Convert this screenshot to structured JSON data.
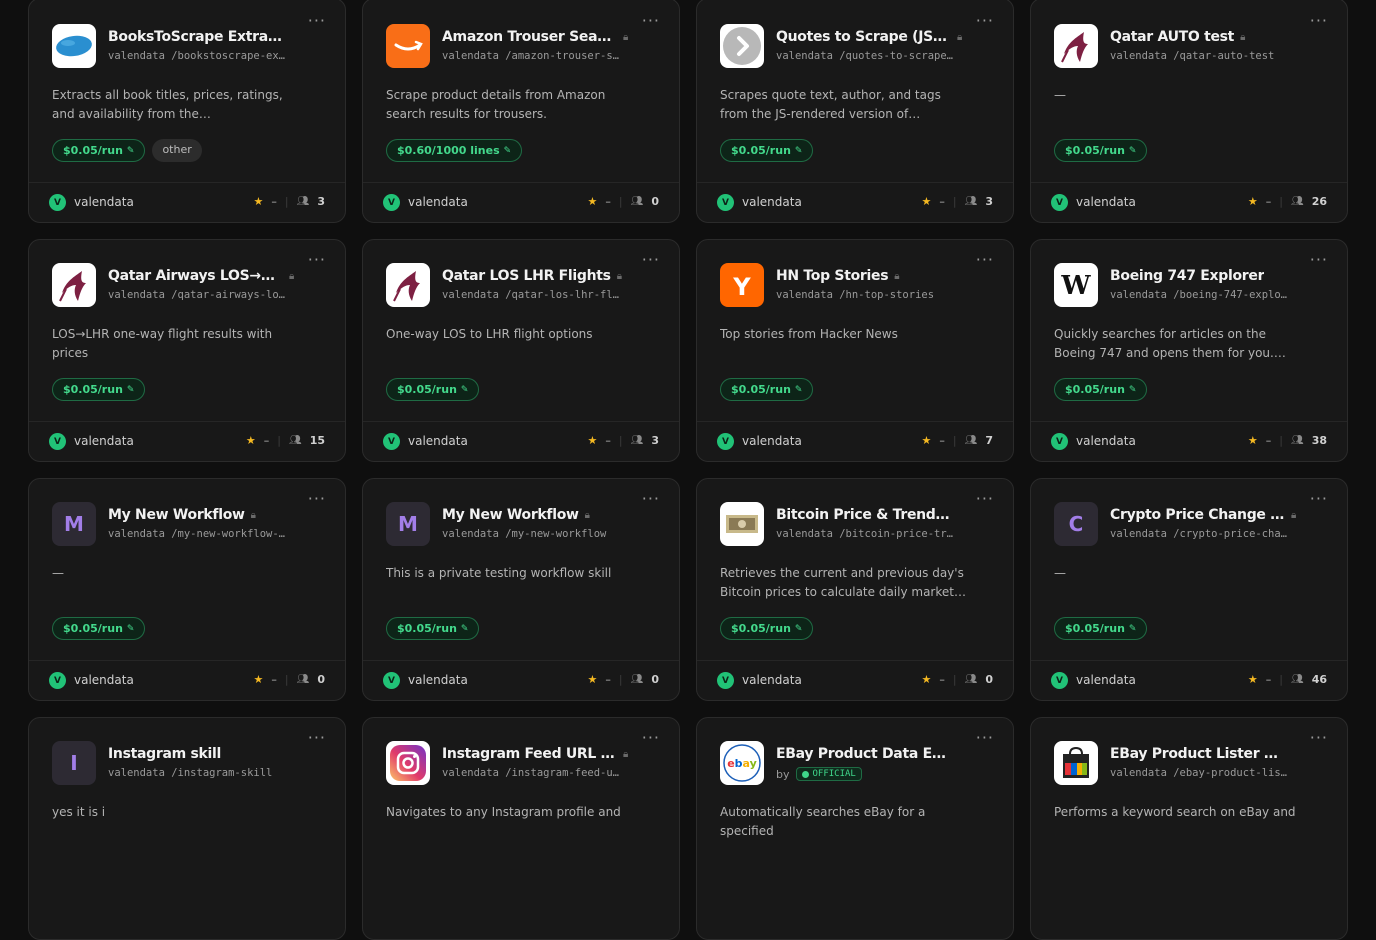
{
  "cards": [
    {
      "title": "BooksToScrape Extractor",
      "slug": "valendata /bookstoscrape-ex…",
      "desc": "Extracts all book titles, prices, ratings, and availability from the books.toscrape.com…",
      "price": "$0.05/run",
      "tag": "other",
      "author": "valendata",
      "avatar": "V",
      "rating": "–",
      "users": "3",
      "locked": false,
      "logo": "books",
      "logo_color": "#2a8fd0",
      "logo_bg": "#ffffff"
    },
    {
      "title": "Amazon Trouser Search …",
      "slug": "valendata /amazon-trouser-s…",
      "desc": "Scrape product details from Amazon search results for trousers.",
      "price": "$0.60/1000 lines",
      "author": "valendata",
      "avatar": "V",
      "rating": "–",
      "users": "0",
      "locked": true,
      "logo": "amazon",
      "logo_color": "#ffffff",
      "logo_bg": "#f96e17"
    },
    {
      "title": "Quotes to Scrape (JS) E…",
      "slug": "valendata /quotes-to-scrape…",
      "desc": "Scrapes quote text, author, and tags from the JS-rendered version of quotes.toscrape.com.",
      "price": "$0.05/run",
      "author": "valendata",
      "avatar": "V",
      "rating": "–",
      "users": "3",
      "locked": true,
      "logo": "chevron",
      "logo_color": "#ffffff",
      "logo_bg": "#ffffff"
    },
    {
      "title": "Qatar AUTO test",
      "slug": "valendata /qatar-auto-test",
      "desc": "—",
      "price": "$0.05/run",
      "author": "valendata",
      "avatar": "V",
      "rating": "–",
      "users": "26",
      "locked": true,
      "logo": "qatar",
      "logo_color": "#7d2042",
      "logo_bg": "#ffffff"
    },
    {
      "title": "Qatar Airways LOS→LH…",
      "slug": "valendata /qatar-airways-lo…",
      "desc": "LOS→LHR one-way flight results with prices",
      "price": "$0.05/run",
      "author": "valendata",
      "avatar": "V",
      "rating": "–",
      "users": "15",
      "locked": true,
      "logo": "qatar",
      "logo_color": "#7d2042",
      "logo_bg": "#ffffff"
    },
    {
      "title": "Qatar LOS LHR Flights",
      "slug": "valendata /qatar-los-lhr-fl…",
      "desc": "One-way LOS to LHR flight options",
      "price": "$0.05/run",
      "author": "valendata",
      "avatar": "V",
      "rating": "–",
      "users": "3",
      "locked": true,
      "logo": "qatar",
      "logo_color": "#7d2042",
      "logo_bg": "#ffffff"
    },
    {
      "title": "HN Top Stories",
      "slug": "valendata /hn-top-stories",
      "desc": "Top stories from Hacker News",
      "price": "$0.05/run",
      "author": "valendata",
      "avatar": "V",
      "rating": "–",
      "users": "7",
      "locked": true,
      "logo": "hn",
      "logo_color": "#ffffff",
      "logo_bg": "#ff6600"
    },
    {
      "title": "Boeing 747 Explorer",
      "slug": "valendata /boeing-747-explo…",
      "desc": "Quickly searches for articles on the Boeing 747 and opens them for you. This skill saves time…",
      "price": "$0.05/run",
      "author": "valendata",
      "avatar": "V",
      "rating": "–",
      "users": "38",
      "locked": false,
      "logo": "wikipedia",
      "logo_color": "#111111",
      "logo_bg": "#ffffff"
    },
    {
      "title": "My New Workflow",
      "slug": "valendata /my-new-workflow-…",
      "desc": "—",
      "price": "$0.05/run",
      "author": "valendata",
      "avatar": "V",
      "rating": "–",
      "users": "0",
      "locked": true,
      "logo": "letter",
      "letter": "M",
      "logo_color": "#a27ee8",
      "logo_bg": "#2d2a33"
    },
    {
      "title": "My New Workflow",
      "slug": "valendata /my-new-workflow",
      "desc": "This is a private testing workflow skill",
      "price": "$0.05/run",
      "author": "valendata",
      "avatar": "V",
      "rating": "–",
      "users": "0",
      "locked": true,
      "logo": "letter",
      "letter": "M",
      "logo_color": "#a27ee8",
      "logo_bg": "#2d2a33"
    },
    {
      "title": "Bitcoin Price & Trend Track…",
      "slug": "valendata /bitcoin-price-tr…",
      "desc": "Retrieves the current and previous day's Bitcoin prices to calculate daily market fluctuations.…",
      "price": "$0.05/run",
      "author": "valendata",
      "avatar": "V",
      "rating": "–",
      "users": "0",
      "locked": false,
      "logo": "bitcoin",
      "logo_color": "#8a7a55",
      "logo_bg": "#ffffff"
    },
    {
      "title": "Crypto Price Change Mo…",
      "slug": "valendata /crypto-price-cha…",
      "desc": "—",
      "price": "$0.05/run",
      "author": "valendata",
      "avatar": "V",
      "rating": "–",
      "users": "46",
      "locked": true,
      "logo": "letter",
      "letter": "C",
      "logo_color": "#a27ee8",
      "logo_bg": "#2d2a33"
    },
    {
      "title": "Instagram skill",
      "slug": "valendata /instagram-skill",
      "desc": "yes it is i",
      "locked": false,
      "logo": "letter",
      "letter": "I",
      "logo_color": "#a27ee8",
      "logo_bg": "#2d2a33"
    },
    {
      "title": "Instagram Feed URL Ext…",
      "slug": "valendata /instagram-feed-u…",
      "desc": "Navigates to any Instagram profile and",
      "locked": true,
      "logo": "instagram",
      "logo_color": "#ffffff",
      "logo_bg": "#ffffff"
    },
    {
      "title": "EBay Product Data Extractor",
      "by": "by",
      "official": "OFFICIAL",
      "desc": "Automatically searches eBay for a specified",
      "locked": false,
      "logo": "ebay",
      "logo_color": "#e53238",
      "logo_bg": "#ffffff"
    },
    {
      "title": "EBay Product Lister & Scra…",
      "slug": "valendata /ebay-product-lis…",
      "desc": "Performs a keyword search on eBay and",
      "locked": false,
      "logo": "bag",
      "logo_color": "#222222",
      "logo_bg": "#ffffff"
    }
  ]
}
